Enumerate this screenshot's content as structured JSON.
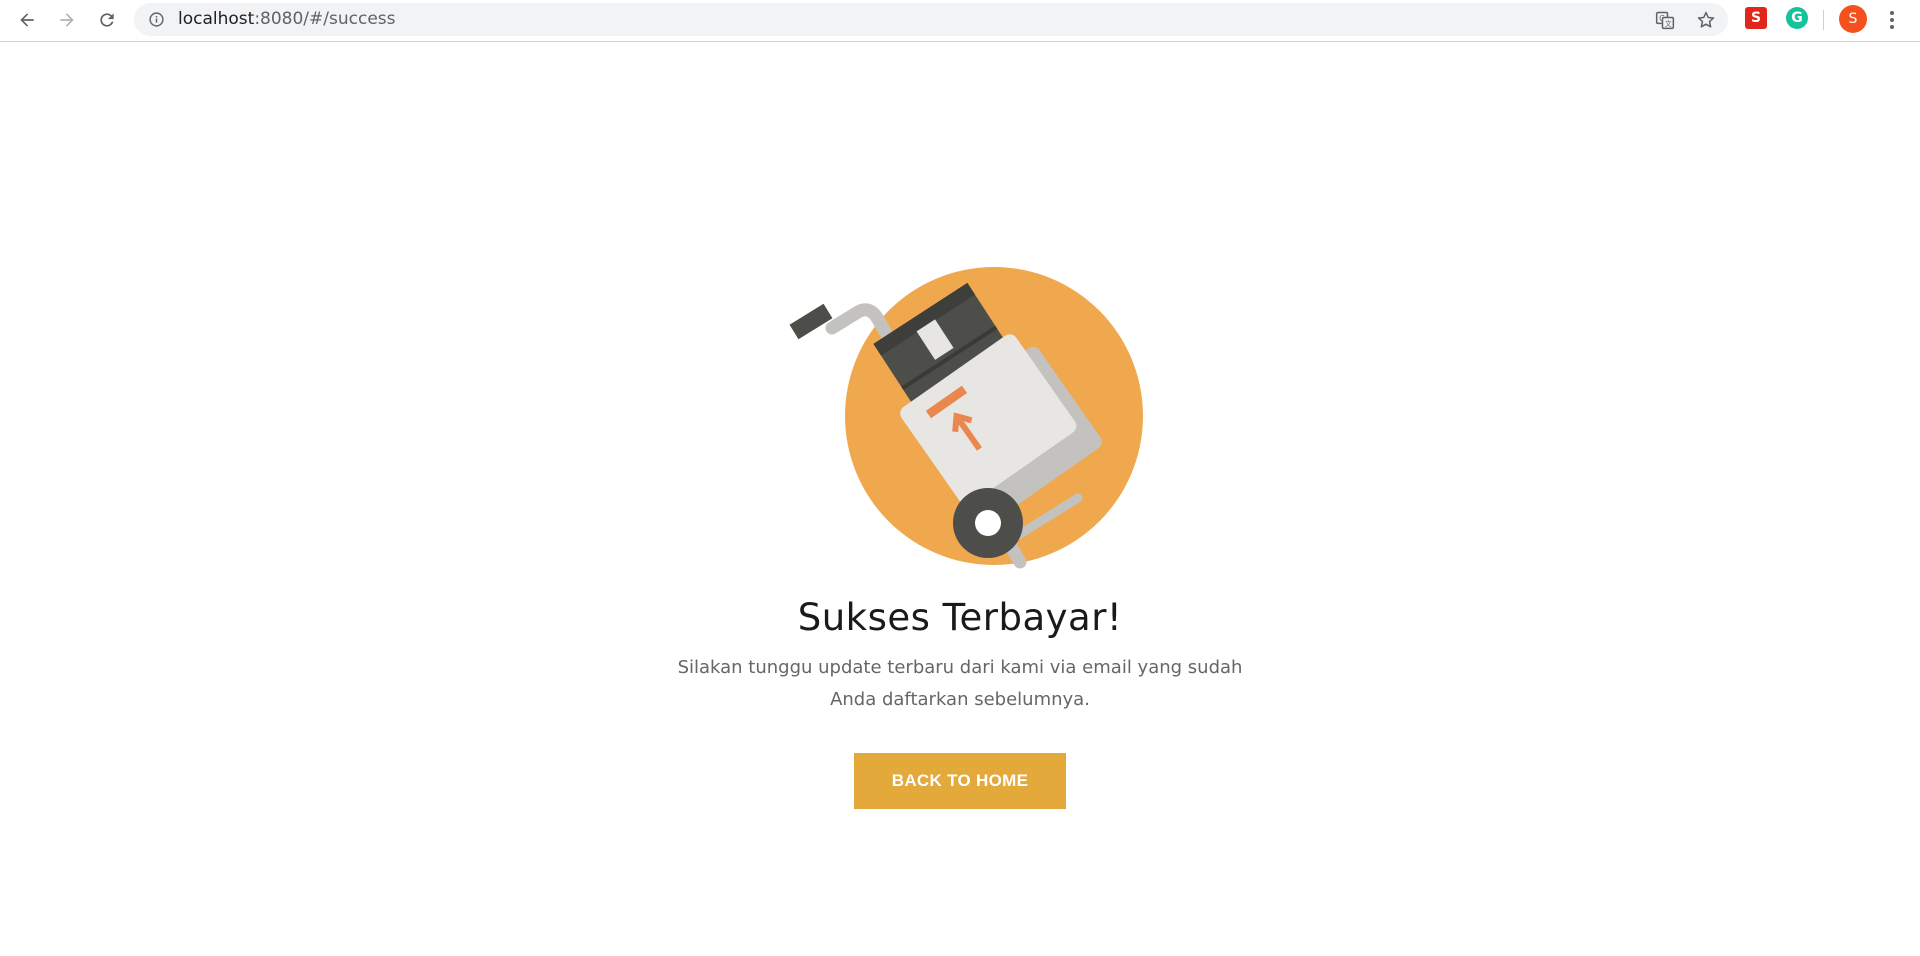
{
  "browser": {
    "url_host": "localhost",
    "url_rest": ":8080/#/success",
    "profile_initial": "S",
    "extension_s_label": "S",
    "extension_g_label": "G"
  },
  "colors": {
    "accent_button": "#e3a93b",
    "illustration_circle": "#f0a84e",
    "box_dark": "#4d4d49",
    "box_light": "#e8e6e3",
    "arrow": "#e9874f"
  },
  "success": {
    "title": "Sukses Terbayar!",
    "message_line1": "Silakan tunggu update terbaru dari kami via email yang sudah",
    "message_line2": "Anda daftarkan sebelumnya.",
    "button_label": "BACK TO HOME"
  }
}
